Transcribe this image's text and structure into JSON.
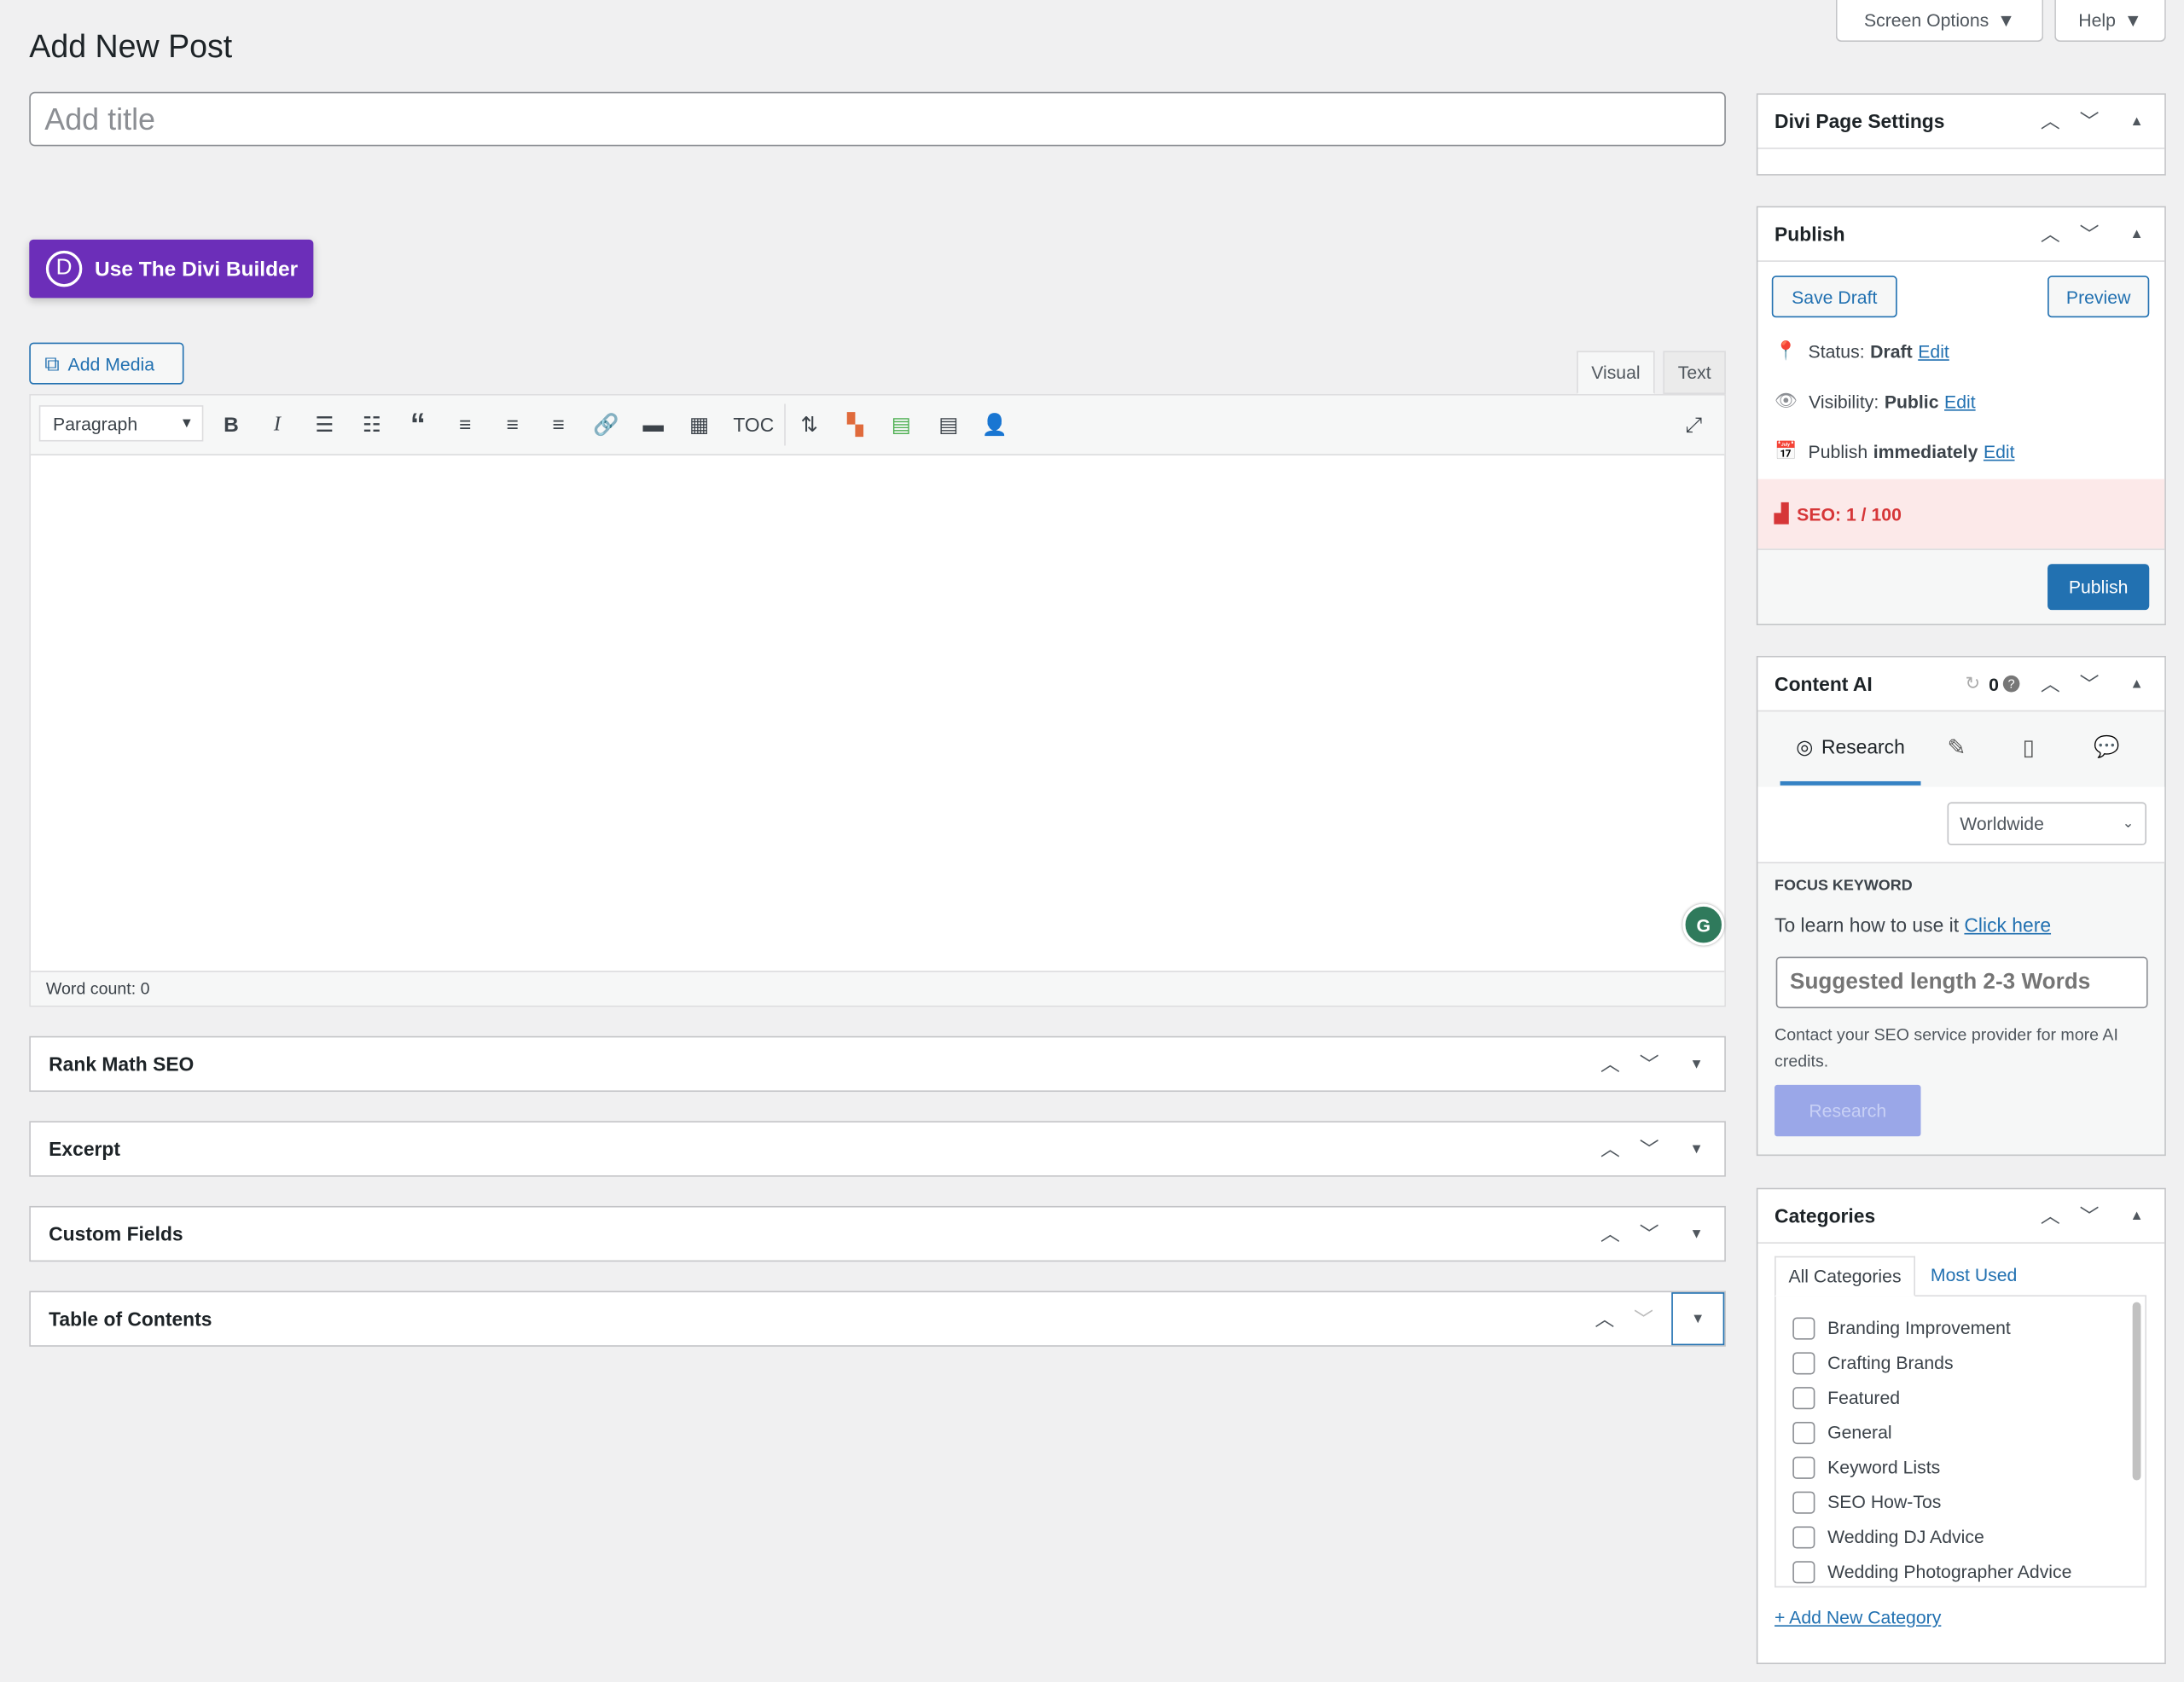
{
  "header": {
    "title": "Add New Post",
    "screen_options": "Screen Options",
    "help": "Help"
  },
  "title_placeholder": "Add title",
  "divi": {
    "label": "Use The Divi Builder",
    "logo": "D"
  },
  "editor": {
    "add_media": "Add Media",
    "tab_visual": "Visual",
    "tab_text": "Text",
    "format": "Paragraph",
    "toc": "TOC",
    "word_count": "Word count: 0",
    "grammarly": "G"
  },
  "metaboxes": [
    "Rank Math SEO",
    "Excerpt",
    "Custom Fields",
    "Table of Contents"
  ],
  "divi_settings": {
    "title": "Divi Page Settings"
  },
  "publish": {
    "title": "Publish",
    "save_draft": "Save Draft",
    "preview": "Preview",
    "status_label": "Status:",
    "status_value": "Draft",
    "visibility_label": "Visibility:",
    "visibility_value": "Public",
    "publish_label": "Publish",
    "publish_value": "immediately",
    "edit": "Edit",
    "seo": "SEO: 1 / 100",
    "publish_button": "Publish"
  },
  "content_ai": {
    "title": "Content AI",
    "credits": "0",
    "tab_research": "Research",
    "region": "Worldwide",
    "focus_heading": "FOCUS KEYWORD",
    "learn": "To learn how to use it",
    "click_here": "Click here",
    "keyword_placeholder": "Suggested length 2-3 Words",
    "contact": "Contact your SEO service provider for more AI credits.",
    "research_button": "Research"
  },
  "categories": {
    "title": "Categories",
    "tab_all": "All Categories",
    "tab_most": "Most Used",
    "items": [
      "Branding Improvement",
      "Crafting Brands",
      "Featured",
      "General",
      "Keyword Lists",
      "SEO How-Tos",
      "Wedding DJ Advice",
      "Wedding Photographer Advice"
    ],
    "add_new": "+ Add New Category"
  },
  "colors": {
    "accent": "#2271b1",
    "divi": "#6c2eb9",
    "seo_bg": "#fce9e9",
    "seo_text": "#d63638",
    "research_disabled": "#9aa7e8"
  }
}
